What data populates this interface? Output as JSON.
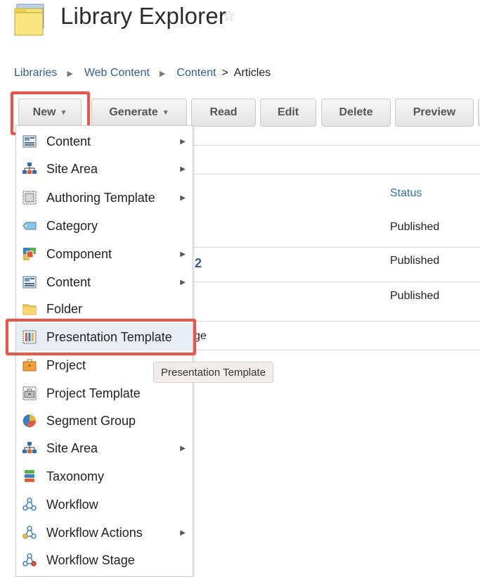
{
  "header": {
    "title": "Library Explorer"
  },
  "breadcrumb": [
    "Libraries",
    "Web Content",
    "Content",
    "Articles"
  ],
  "toolbar": {
    "new": "New",
    "generate": "Generate",
    "read": "Read",
    "edit": "Edit",
    "delete": "Delete",
    "preview": "Preview"
  },
  "table": {
    "status_header": "Status",
    "statuses": [
      "Published",
      "Published",
      "Published"
    ],
    "partial_link": "2",
    "partial_text": "ge"
  },
  "menu": {
    "items": [
      {
        "label": "Content",
        "icon": "content-icon",
        "submenu": true
      },
      {
        "label": "Site Area",
        "icon": "site-area-icon",
        "submenu": true
      },
      {
        "label": "Authoring Template",
        "icon": "authoring-template-icon",
        "submenu": true
      },
      {
        "label": "Category",
        "icon": "category-icon",
        "submenu": false
      },
      {
        "label": "Component",
        "icon": "component-icon",
        "submenu": true
      },
      {
        "label": "Content",
        "icon": "content-icon",
        "submenu": true
      },
      {
        "label": "Folder",
        "icon": "folder-icon",
        "submenu": false
      },
      {
        "label": "Presentation Template",
        "icon": "presentation-template-icon",
        "submenu": false
      },
      {
        "label": "Project",
        "icon": "project-icon",
        "submenu": false
      },
      {
        "label": "Project Template",
        "icon": "project-template-icon",
        "submenu": false
      },
      {
        "label": "Segment Group",
        "icon": "segment-group-icon",
        "submenu": false
      },
      {
        "label": "Site Area",
        "icon": "site-area-icon",
        "submenu": true
      },
      {
        "label": "Taxonomy",
        "icon": "taxonomy-icon",
        "submenu": false
      },
      {
        "label": "Workflow",
        "icon": "workflow-icon",
        "submenu": false
      },
      {
        "label": "Workflow Actions",
        "icon": "workflow-actions-icon",
        "submenu": true
      },
      {
        "label": "Workflow Stage",
        "icon": "workflow-stage-icon",
        "submenu": false
      }
    ],
    "tooltip": "Presentation Template"
  },
  "colors": {
    "highlight": "#e8564b",
    "link": "#2f5f93"
  }
}
